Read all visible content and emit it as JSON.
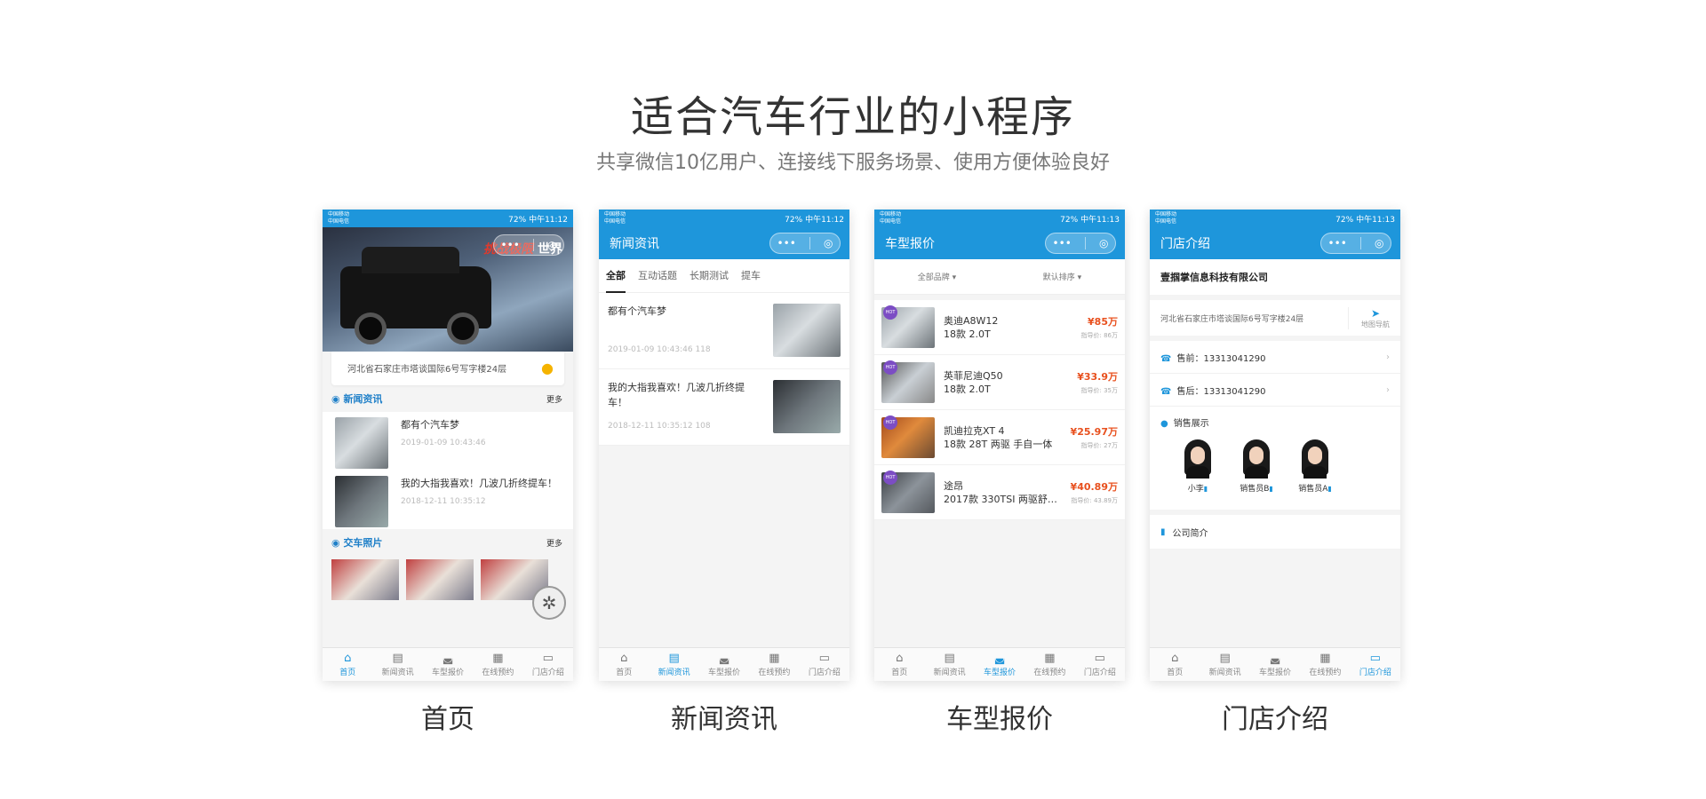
{
  "header": {
    "title": "适合汽车行业的小程序",
    "subtitle": "共享微信10亿用户、连接线下服务场景、使用方便体验良好"
  },
  "status_bar": {
    "carrier_1": "中国移动",
    "carrier_2": "中国电信",
    "signal": "72%",
    "times": [
      "中午11:12",
      "中午11:12",
      "中午11:13",
      "中午11:13"
    ]
  },
  "capsule": {
    "menu": "•••",
    "close": "◎"
  },
  "tabbar": {
    "items": [
      {
        "label": "首页",
        "icon": "home-icon"
      },
      {
        "label": "新闻资讯",
        "icon": "news-icon"
      },
      {
        "label": "车型报价",
        "icon": "car-icon"
      },
      {
        "label": "在线预约",
        "icon": "clipboard-icon"
      },
      {
        "label": "门店介绍",
        "icon": "store-icon"
      }
    ]
  },
  "phones": {
    "home": {
      "caption": "首页",
      "banner_slogan_a": "挑战",
      "banner_slogan_b": "极限",
      "banner_slogan_c": "世界",
      "address": "河北省石家庄市塔谈国际6号写字楼24层",
      "news_section": "新闻资讯",
      "more": "更多",
      "news": [
        {
          "title": "都有个汽车梦",
          "date": "2019-01-09 10:43:46"
        },
        {
          "title": "我的大指我喜欢！几波几折终提车！",
          "date": "2018-12-11 10:35:12"
        }
      ],
      "photos_section": "交车照片"
    },
    "news": {
      "caption": "新闻资讯",
      "nav_title": "新闻资讯",
      "tabs": [
        "全部",
        "互动话题",
        "长期测试",
        "提车"
      ],
      "items": [
        {
          "title": "都有个汽车梦",
          "meta": "2019-01-09 10:43:46   118"
        },
        {
          "title": "我的大指我喜欢！几波几折终提车！",
          "meta": "2018-12-11 10:35:12   108"
        }
      ]
    },
    "price": {
      "caption": "车型报价",
      "nav_title": "车型报价",
      "filter_brand": "全部品牌 ▾",
      "filter_sort": "默认排序 ▾",
      "hot": "HOT",
      "cars": [
        {
          "name": "奥迪A8W12",
          "spec": "18款 2.0T",
          "price": "¥85万",
          "guide": "指导价: 86万"
        },
        {
          "name": "英菲尼迪Q50",
          "spec": "18款 2.0T",
          "price": "¥33.9万",
          "guide": "指导价: 35万"
        },
        {
          "name": "凯迪拉克XT 4",
          "spec": "18款 28T 两驱 手自一体",
          "price": "¥25.97万",
          "guide": "指导价: 27万"
        },
        {
          "name": "途昂",
          "spec": "2017款 330TSI 两驱舒…",
          "price": "¥40.89万",
          "guide": "指导价: 43.89万"
        }
      ]
    },
    "store": {
      "caption": "门店介绍",
      "nav_title": "门店介绍",
      "company": "壹掴掌信息科技有限公司",
      "address": "河北省石家庄市塔谈国际6号写字楼24层",
      "map_nav": "地图导航",
      "presale": "售前：13313041290",
      "aftersale": "售后：13313041290",
      "staff_section": "销售展示",
      "staff": [
        "小李",
        "销售员B",
        "销售员A"
      ],
      "intro": "公司简介"
    }
  }
}
